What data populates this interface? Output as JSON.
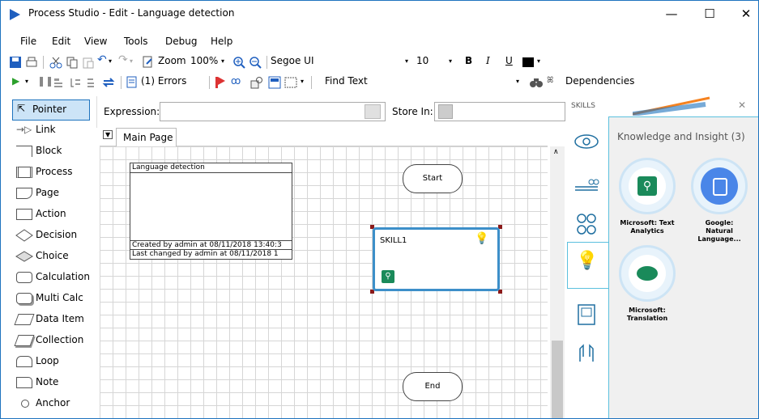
{
  "window": {
    "title": "Process Studio  - Edit - Language detection",
    "minimize": "—",
    "maximize": "☐",
    "close": "✕"
  },
  "menu": [
    "File",
    "Edit",
    "View",
    "Tools",
    "Debug",
    "Help"
  ],
  "toolbar1": {
    "zoom_label": "Zoom",
    "zoom_value": "100%",
    "font_name": "Segoe UI",
    "font_size": "10",
    "bold": "B",
    "italic": "I",
    "underline": "U"
  },
  "toolbar2": {
    "errors": "(1) Errors",
    "find_text": "Find Text",
    "dependencies": "Dependencies"
  },
  "expression": {
    "label": "Expression:",
    "store_in_label": "Store In:"
  },
  "tools": [
    "Pointer",
    "Link",
    "Block",
    "Process",
    "Page",
    "Action",
    "Decision",
    "Choice",
    "Calculation",
    "Multi Calc",
    "Data Item",
    "Collection",
    "Loop",
    "Note",
    "Anchor"
  ],
  "page_tab": {
    "label": "Main Page"
  },
  "diagram": {
    "info_title": "Language detection",
    "created": "Created  by  admin  at 08/11/2018 13:40:3",
    "changed": "Last changed by admin at 08/11/2018 1",
    "start": "Start",
    "end": "End",
    "skill_name": "SKILL1"
  },
  "skills": {
    "header": "SKILLS",
    "group_title": "Knowledge and Insight (3)",
    "items": [
      {
        "name": "Microsoft: Text Analytics"
      },
      {
        "name": "Google: Natural Language..."
      },
      {
        "name": "Microsoft: Translation"
      }
    ]
  },
  "colors": {
    "accent": "#1e73be",
    "skill_green": "#1a8a5a",
    "google_blue": "#4a86e8",
    "skill_border": "#3d8fc9",
    "handle": "#8b1a1a"
  }
}
